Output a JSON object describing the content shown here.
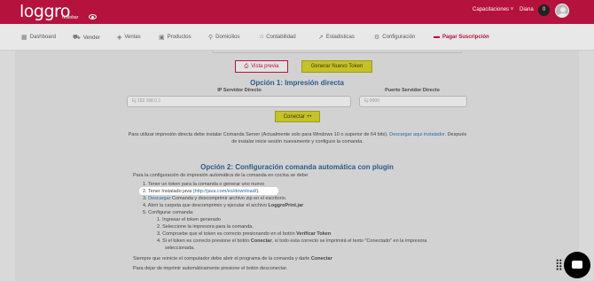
{
  "colors": {
    "brand": "#b5123e",
    "accent_button": "#c5c129",
    "heading": "#2a5a8a",
    "link": "#2a6aa8"
  },
  "header": {
    "logo": "loggro",
    "logo_sub": "restobar",
    "capacitaciones": "Capacitaciones",
    "user_name": "Diana",
    "cart_count": "0"
  },
  "nav": {
    "items": [
      {
        "label": "Dashboard",
        "icon": "grid-icon"
      },
      {
        "label": "Vender",
        "icon": "cart-icon"
      },
      {
        "label": "Ventas",
        "icon": "tag-icon"
      },
      {
        "label": "Productos",
        "icon": "box-icon"
      },
      {
        "label": "Domicilios",
        "icon": "bike-icon"
      },
      {
        "label": "Contabilidad",
        "icon": "bank-icon"
      },
      {
        "label": "Estadisticas",
        "icon": "trend-icon"
      },
      {
        "label": "Configuración",
        "icon": "gear-icon"
      },
      {
        "label": "Pagar Suscripción",
        "icon": "card-icon"
      }
    ]
  },
  "actions": {
    "preview": "Vista previa",
    "generate_token": "Generar Nuevo Token"
  },
  "option1": {
    "title": "Opción 1: Impresión directa",
    "ip_label": "IP Servidor Directo",
    "ip_placeholder": "Ej 192.168.0.1",
    "port_label": "Puerto Servidor Directo",
    "port_placeholder": "Ej 9000",
    "connect": "Conectar +•",
    "note_pre": "Para utilizar impresión directa debe instalar Comanda Server (Actualmente solo para Windows 10 o superior de 64 bits).",
    "note_link": "Descargar aqui instalador.",
    "note_post": "Después de instalar inicie sesión nuevamente y configure la comanda."
  },
  "option2": {
    "title": "Opción 2: Configuración comanda automática con plugin",
    "intro": "Para la configuración de impresión automática de la comanda en cocina se debe:",
    "step1": "1. Tener un token para la comanda o generar uno nuevo",
    "step2_pre": "2. Tener Instalado java (",
    "step2_link": "http://java.com/es/download/",
    "step2_post": ").",
    "step3_link": "Descargar",
    "step3_text": "Comanda y descomprimir archivo zip en el escritorio.",
    "step4_pre": "4. Abrir la carpeta que descomprimio y ejecutar el archivo",
    "step4_bold": "LoggroPrint.jar",
    "step5": "5. Configurar comanda:",
    "sub1": "1. Ingresar el token generado",
    "sub2": "2. Seleccione la impresora para la comanda.",
    "sub3_pre": "3. Compruebe que el token es correcto presionando en el botón",
    "sub3_bold": "Verificar Token",
    "sub4_pre": "4. Si el token es correcto presione el botón",
    "sub4_bold": "Conectar",
    "sub4_post": ", si todo esta correcto se imprimirá el texto \"Conectado\" en la impresora",
    "sub4_cont": "seleccionada.",
    "restart_pre": "Siempre que reinicie el computador debe abrir el programa de la comanda y darle",
    "restart_bold": "Conectar",
    "stop": "Para dejar de imprimir automáticamente presione el botón desconectar."
  }
}
